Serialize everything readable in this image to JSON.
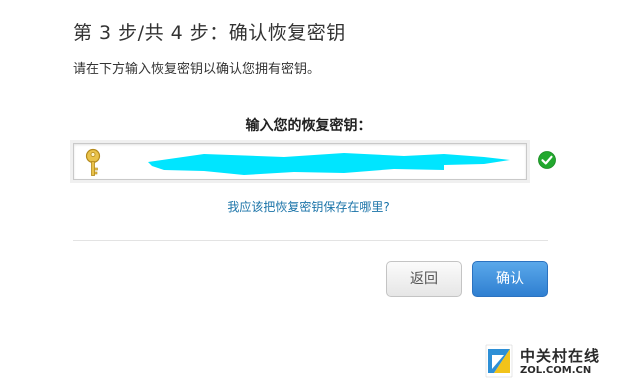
{
  "header": {
    "step_title": "第 3 步/共 4 步：确认恢复密钥",
    "description": "请在下方输入恢复密钥以确认您拥有密钥。"
  },
  "key_entry": {
    "label": "输入您的恢复密钥：",
    "value": "",
    "key_icon": "key-icon",
    "status_icon": "check-circle-icon",
    "status_color": "#22a82e",
    "redaction_color": "#00e5ff"
  },
  "help_link": "我应该把恢复密钥保存在哪里?",
  "buttons": {
    "back_label": "返回",
    "confirm_label": "确认",
    "confirm_color": "#3d8fdc"
  },
  "watermark": {
    "name": "中关村在线",
    "domain": "ZOL.COM.CN"
  }
}
